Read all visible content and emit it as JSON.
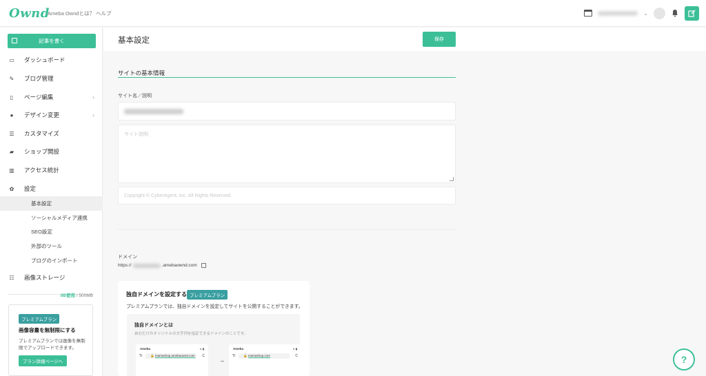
{
  "topbar": {
    "logo": "Ownd",
    "links": [
      "Ameba Owndとは？",
      "ヘルプ"
    ],
    "account_chevron": "⌄"
  },
  "sidebar": {
    "write_button": "記事を書く",
    "items": [
      {
        "label": "ダッシュボード",
        "icon": "calendar-icon"
      },
      {
        "label": "ブログ管理",
        "icon": "edit-icon"
      },
      {
        "label": "ページ編集",
        "icon": "page-icon"
      },
      {
        "label": "デザイン変更",
        "icon": "palette-icon"
      },
      {
        "label": "カスタマイズ",
        "icon": "sliders-icon"
      },
      {
        "label": "ショップ開設",
        "icon": "shop-icon"
      },
      {
        "label": "アクセス統計",
        "icon": "bar-chart-icon"
      },
      {
        "label": "設定",
        "icon": "gear-icon"
      }
    ],
    "sub_items": [
      "基本設定",
      "ソーシャルメディア連携",
      "SEO設定",
      "外部のツール",
      "ブログのインポート"
    ],
    "storage_label": "画像ストレージ",
    "storage_used": "0B使用",
    "storage_total": "/ 500MB",
    "promo": {
      "badge": "プレミアムプラン",
      "title": "画像容量を無制限にする",
      "desc": "プレミアムプランでは画像を無制限でアップロードできます。",
      "button": "プラン詳細ページへ"
    }
  },
  "main": {
    "title": "基本設定",
    "save": "保存",
    "section_title": "サイトの基本情報",
    "site_name_label": "サイト名／説明",
    "description_placeholder": "サイト説明",
    "copyright_placeholder": "Copyright © CyberAgent, Inc. All Rights Reserved.",
    "domain_label": "ドメイン",
    "domain_prefix": "https://",
    "domain_suffix": ".amebaownd.com",
    "custom_domain": {
      "title": "独自ドメインを設定する",
      "badge": "プレミアムプラン",
      "desc": "プレミアムプランでは、独自ドメインを設定してサイトを公開することができます。",
      "inner_title": "独自ドメインとは",
      "inner_desc": "自分だけのオリジナルの文字列を指定できるドメインのことです。",
      "phone_brand": "Ameba",
      "phone_left": "Tr",
      "phone_right": "C",
      "url_before": "mamashop.amebaownd.com",
      "url_after": "mamashop.com",
      "arrow": "→"
    },
    "help": "?"
  },
  "colors": {
    "accent": "#3cbf97",
    "badge": "#3a9fa0"
  }
}
